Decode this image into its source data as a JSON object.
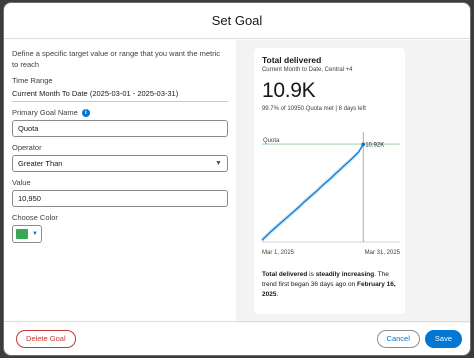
{
  "modal": {
    "title": "Set Goal"
  },
  "form": {
    "description": "Define a specific target value or range that you want the metric to reach",
    "time_range": {
      "label": "Time Range",
      "value": "Current Month To Date (2025-03-01 - 2025-03-31)"
    },
    "goal_name": {
      "label": "Primary Goal Name",
      "value": "Quota"
    },
    "operator": {
      "label": "Operator",
      "value": "Greater Than"
    },
    "value": {
      "label": "Value",
      "value": "10,950"
    },
    "color": {
      "label": "Choose Color",
      "swatch": "#3ba755"
    }
  },
  "card": {
    "title": "Total delivered",
    "subtitle": "Current Month to Date, Central +4",
    "big_value": "10.9K",
    "quota_line": "99.7% of 10950 Quota met | 8 days left",
    "insight_pre": "Total delivered",
    "insight_mid": " is ",
    "insight_trend": "steadily increasing",
    "insight_post": ". The trend first began 36 days ago on ",
    "insight_date": "February 16, 2025",
    "insight_end": "."
  },
  "chart_data": {
    "type": "line",
    "x_start_label": "Mar 1, 2025",
    "x_end_label": "Mar 31, 2025",
    "quota_label": "Quota",
    "quota_value": 10950,
    "end_value_label": "10.92K",
    "line_color": "#0176d3",
    "band_color": "#b9d9f3",
    "quota_color": "#8fc89a",
    "x": [
      1,
      2,
      3,
      4,
      5,
      6,
      7,
      8,
      9,
      10,
      11,
      12,
      13,
      14,
      15,
      16,
      17,
      18,
      19,
      20,
      21,
      22,
      23
    ],
    "y": [
      200,
      700,
      1200,
      1650,
      2100,
      2550,
      3000,
      3450,
      3900,
      4400,
      4850,
      5300,
      5750,
      6250,
      6700,
      7150,
      7650,
      8100,
      8600,
      9050,
      9550,
      10050,
      10920
    ],
    "xlim": [
      1,
      31
    ],
    "ylim": [
      0,
      12300
    ]
  },
  "footer": {
    "delete_label": "Delete Goal",
    "cancel_label": "Cancel",
    "save_label": "Save"
  }
}
